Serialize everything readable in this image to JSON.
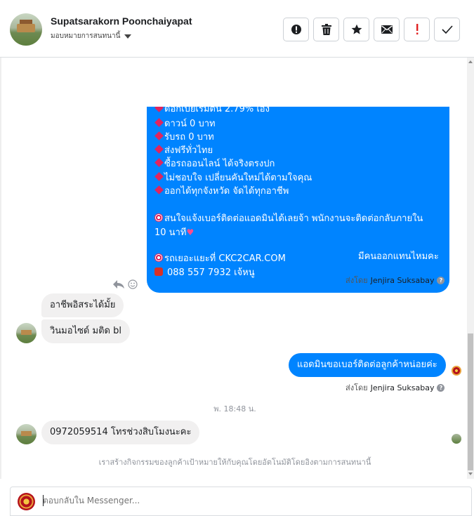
{
  "header": {
    "name": "Supatsarakorn Poonchaiyapat",
    "assign_label": "มอบหมายการสนทนานี้",
    "actions": [
      "spam-icon",
      "trash-icon",
      "star-icon",
      "envelope-icon",
      "important-icon",
      "check-icon"
    ]
  },
  "big_message": {
    "lines": [
      "ดอกเบี้ยเริ่มต้น 2.79% เอง",
      "ดาวน์ 0 บาท",
      "รับรถ 0 บาท",
      "ส่งฟรีทั่วไทย",
      "ซื้อรถออนไลน์ ได้จริงตรงปก",
      "ไม่ชอบใจ เปลี่ยนคันใหม่ได้ตามใจคุณ",
      "ออกได้ทุกจังหวัด จัดได้ทุกอาชีพ"
    ],
    "cta_line1": "สนใจแจ้งเบอร์ติดต่อแอดมินได้เลยจ้า พนักงานจะติดต่อกลับภายใน",
    "cta_line2": "10 นาที",
    "site_line": "รถเยอะแยะที่ CKC2CAR.COM",
    "phone_line": "088 557 7932 เจ้หนู"
  },
  "messages": {
    "out1": "มีคนออกแทนไหมคะ",
    "sentby_prefix": "ส่งโดย",
    "sentby_name": "Jenjira Suksabay",
    "in1": "อาชีพอิสระได้มั้ย",
    "in2": "วินมอไซด์ มติด bl",
    "out2": "แอดมินขอเบอร์ติดต่อลูกค้าหน่อยค่ะ",
    "timestamp": "พ. 18:48 น.",
    "in3": "0972059514 โทรช่วงสิบโมงนะคะ",
    "notice": "เราสร้างกิจกรรมของลูกค้าเป้าหมายให้กับคุณโดยอัตโนมัติโดยอิงตามการสนทนานี้"
  },
  "composer": {
    "placeholder": "ตอบกลับใน Messenger..."
  },
  "colors": {
    "outgoing_bubble": "#0084ff",
    "incoming_bubble": "#f1f0f0",
    "accent_red": "#e0245e"
  }
}
